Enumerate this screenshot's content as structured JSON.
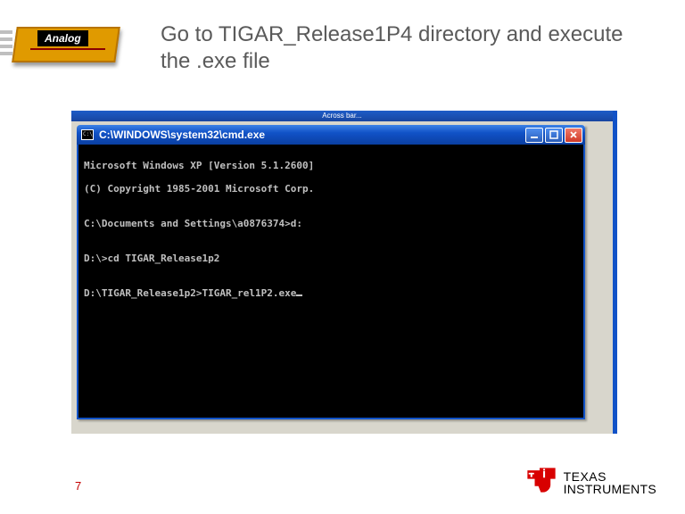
{
  "logo": {
    "band_label": "Analog"
  },
  "title": "Go to TIGAR_Release1P4 directory and execute the .exe file",
  "outer_titlebar": "Across bar...",
  "cmd": {
    "title": "C:\\WINDOWS\\system32\\cmd.exe",
    "lines": [
      "Microsoft Windows XP [Version 5.1.2600]",
      "(C) Copyright 1985-2001 Microsoft Corp.",
      "",
      "C:\\Documents and Settings\\a0876374>d:",
      "",
      "D:\\>cd TIGAR_Release1p2",
      "",
      "D:\\TIGAR_Release1p2>TIGAR_rel1P2.exe"
    ]
  },
  "page_number": "7",
  "footer_logo": {
    "line1": "TEXAS",
    "line2": "INSTRUMENTS"
  },
  "icons": {
    "minimize": "minimize-icon",
    "maximize": "maximize-icon",
    "close": "close-icon"
  }
}
